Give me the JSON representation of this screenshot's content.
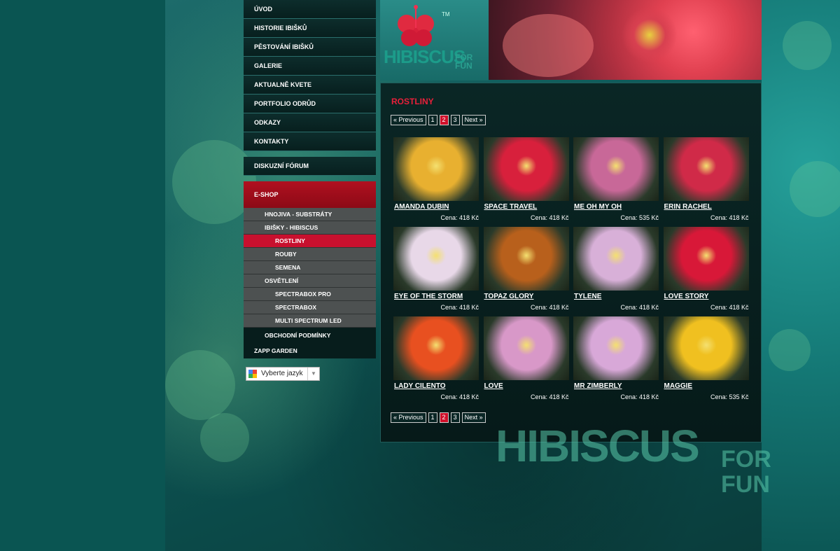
{
  "nav": {
    "items": [
      "ÚVOD",
      "HISTORIE IBIŠKŮ",
      "PĚSTOVÁNÍ IBIŠKŮ",
      "GALERIE",
      "AKTUALNĚ KVETE",
      "PORTFOLIO ODRŮD",
      "ODKAZY",
      "KONTAKTY"
    ],
    "forum": "DISKUZNÍ FÓRUM",
    "eshop": "E-SHOP",
    "sub": {
      "hnojiva": "HNOJIVA - SUBSTRÁTY",
      "ibisky": "IBIŠKY - HIBISCUS",
      "rostliny": "ROSTLINY",
      "rouby": "ROUBY",
      "semena": "SEMENA",
      "osvetleni": "OSVĚTLENÍ",
      "spectrabox_pro": "SPECTRABOX PRO",
      "spectrabox": "SPECTRABOX",
      "multi": "MULTI SPECTRUM LED",
      "obchodni": "OBCHODNÍ PODMÍNKY",
      "zapp": "ZAPP GARDEN"
    }
  },
  "language": {
    "label": "Vyberte jazyk"
  },
  "logo": {
    "main": "HIBISCUS",
    "for": "FOR",
    "fun": "FUN",
    "tm": "TM"
  },
  "page": {
    "title": "ROSTLINY"
  },
  "pager": {
    "prev": "« Previous",
    "pages": [
      "1",
      "2",
      "3"
    ],
    "current": "2",
    "next": "Next »"
  },
  "products": [
    {
      "name": "AMANDA DUBIN",
      "price": "Cena: 418 Kč",
      "color": "#e8b030"
    },
    {
      "name": "SPACE TRAVEL",
      "price": "Cena: 418 Kč",
      "color": "#d8203c"
    },
    {
      "name": "ME OH MY OH",
      "price": "Cena: 535 Kč",
      "color": "#c86898"
    },
    {
      "name": "ERIN RACHEL",
      "price": "Cena: 418 Kč",
      "color": "#d02a48"
    },
    {
      "name": "EYE OF THE STORM",
      "price": "Cena: 418 Kč",
      "color": "#e8d8e8"
    },
    {
      "name": "TOPAZ GLORY",
      "price": "Cena: 418 Kč",
      "color": "#b8601c"
    },
    {
      "name": "TYLENE",
      "price": "Cena: 418 Kč",
      "color": "#d8b0d8"
    },
    {
      "name": "LOVE STORY",
      "price": "Cena: 418 Kč",
      "color": "#d81838"
    },
    {
      "name": "LADY CILENTO",
      "price": "Cena: 418 Kč",
      "color": "#e85020"
    },
    {
      "name": "LOVE",
      "price": "Cena: 418 Kč",
      "color": "#d898c8"
    },
    {
      "name": "MR ZIMBERLY",
      "price": "Cena: 418 Kč",
      "color": "#d8a8d8"
    },
    {
      "name": "MAGGIE",
      "price": "Cena: 535 Kč",
      "color": "#f0c020"
    }
  ],
  "watermark": {
    "main": "HIBISCUS",
    "for": "FOR",
    "fun": "FUN"
  }
}
